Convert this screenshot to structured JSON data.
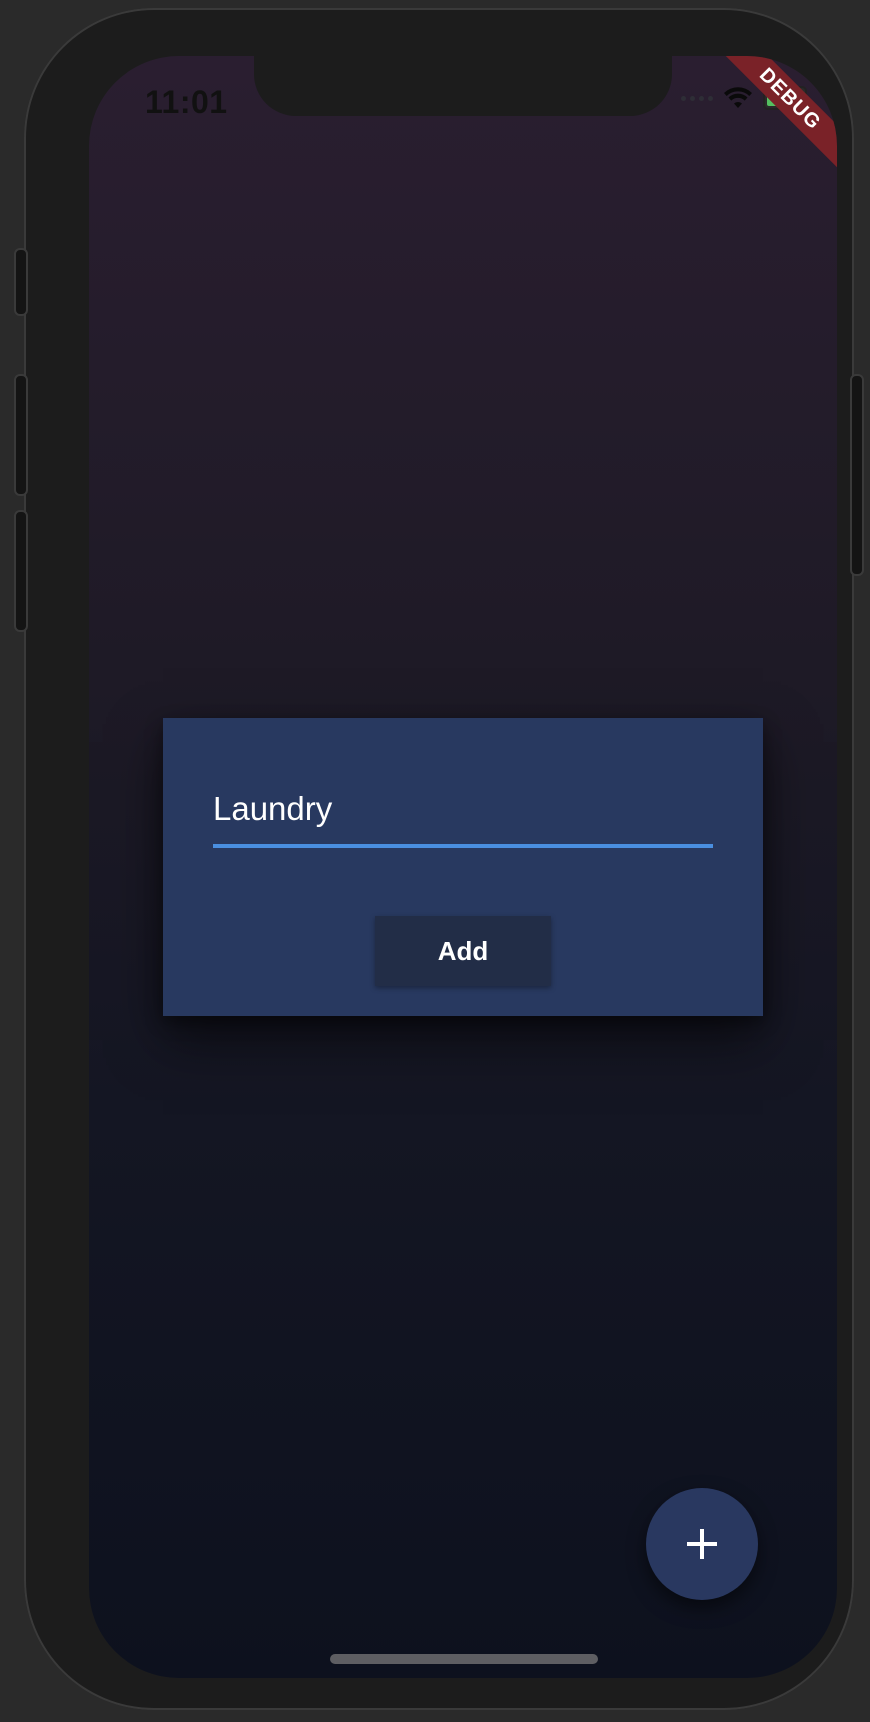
{
  "status_bar": {
    "time": "11:01",
    "debug_banner": "DEBUG",
    "wifi_icon": "wifi-icon",
    "battery_icon": "battery-icon"
  },
  "dialog": {
    "input_value": "Laundry",
    "add_label": "Add"
  },
  "fab": {
    "icon": "plus-icon"
  },
  "colors": {
    "dialog_bg": "#283960",
    "accent_underline": "#4a8fe0",
    "debug_banner": "#7a2228",
    "fab_bg": "#293860"
  }
}
